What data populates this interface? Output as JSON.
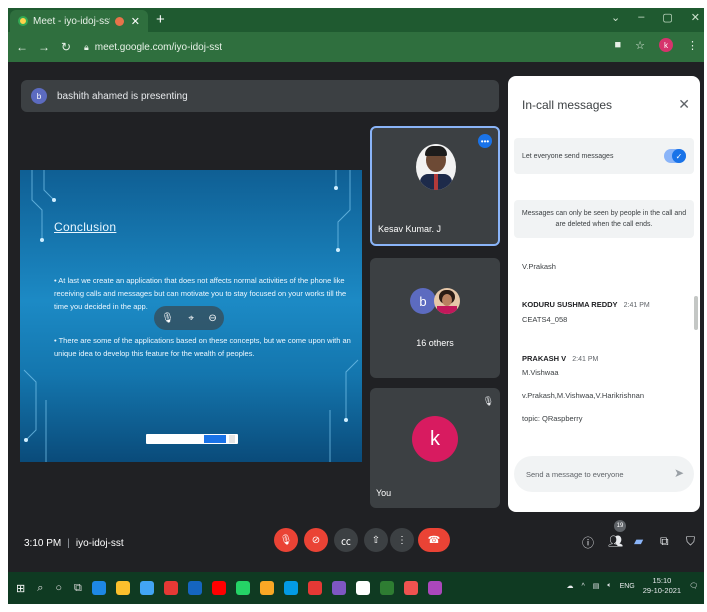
{
  "browser": {
    "tab_title": "Meet - iyo-idoj-sst",
    "tab_close": "✕",
    "new_tab": "+",
    "url": "meet.google.com/iyo-idoj-sst",
    "profile_initial": "k",
    "window_controls": [
      "⌄",
      "–",
      "▢",
      "✕"
    ]
  },
  "presenting": {
    "avatar_initial": "b",
    "text": "bashith ahamed is presenting"
  },
  "slide": {
    "title": "Conclusion",
    "paragraph_1": "• At last we create an application that does not affects normal activities of the phone like receiving calls and messages but can motivate you to stay focused on your works till the time you decided in the app.",
    "paragraph_2": "• There are some of the applications based on these concepts, but we come upon with an unique idea to develop this feature for the wealth of peoples."
  },
  "participants": [
    {
      "name": "Kesav Kumar. J"
    },
    {
      "avatar_initial": "b",
      "label": "16 others"
    },
    {
      "avatar_initial": "k",
      "name": "You"
    }
  ],
  "chat": {
    "header": "In-call messages",
    "toggle_label": "Let everyone send messages",
    "notice": "Messages can only be seen by people in the call and are deleted when the call ends.",
    "messages": [
      {
        "sender": "",
        "time": "",
        "lines": [
          "V.Prakash"
        ]
      },
      {
        "sender": "KODURU SUSHMA REDDY",
        "time": "2:41 PM",
        "lines": [
          "CEATS4_058"
        ]
      },
      {
        "sender": "PRAKASH V",
        "time": "2:41 PM",
        "lines": [
          "M.Vishwaa",
          "v.Prakash,M.Vishwaa,V.Harikrishnan",
          "topic: QRaspberry"
        ]
      }
    ],
    "input_placeholder": "Send a message to everyone"
  },
  "bottom": {
    "time": "3:10 PM",
    "meeting_code": "iyo-idoj-sst",
    "participant_count": "19"
  },
  "taskbar": {
    "clock_time": "15:10",
    "clock_date": "29-10-2021",
    "lang": "ENG"
  },
  "colors": {
    "meet_bg": "#202124",
    "tile_bg": "#3c4043",
    "end_call": "#ea4335",
    "accent": "#1a73e8"
  }
}
